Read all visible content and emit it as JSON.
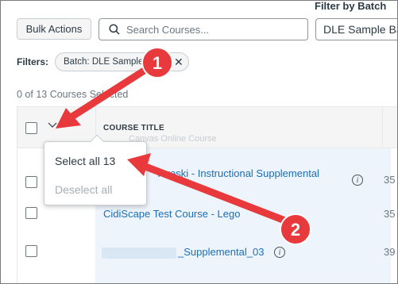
{
  "header": {
    "filter_by_batch_label": "Filter by Batch",
    "bulk_actions_label": "Bulk Actions",
    "search_placeholder": "Search Courses...",
    "batch_selected_value": "DLE Sample Batch"
  },
  "filters": {
    "label": "Filters:",
    "chip_label": "Batch: DLE Sample Batch",
    "chip_remove_glyph": "✕"
  },
  "selection_count": "0 of 13 Courses Selected",
  "table": {
    "header_title": "COURSE TITLE",
    "header_ghost_row": "Canvas Online Course",
    "rows": [
      {
        "title": "Tereski - Instructional Supplemental",
        "number": "35"
      },
      {
        "title": "CidiScape Test Course - Lego",
        "number": "35"
      },
      {
        "title": "_Supplemental_03",
        "number": "39"
      }
    ]
  },
  "select_menu": {
    "select_all_label": "Select all 13",
    "deselect_all_label": "Deselect all"
  },
  "annotations": {
    "step1": "1",
    "step2": "2",
    "color": "#e8393d"
  },
  "colors": {
    "link": "#1b6eb8",
    "text": "#2d3b45",
    "header_bg": "#f5f5f5"
  }
}
